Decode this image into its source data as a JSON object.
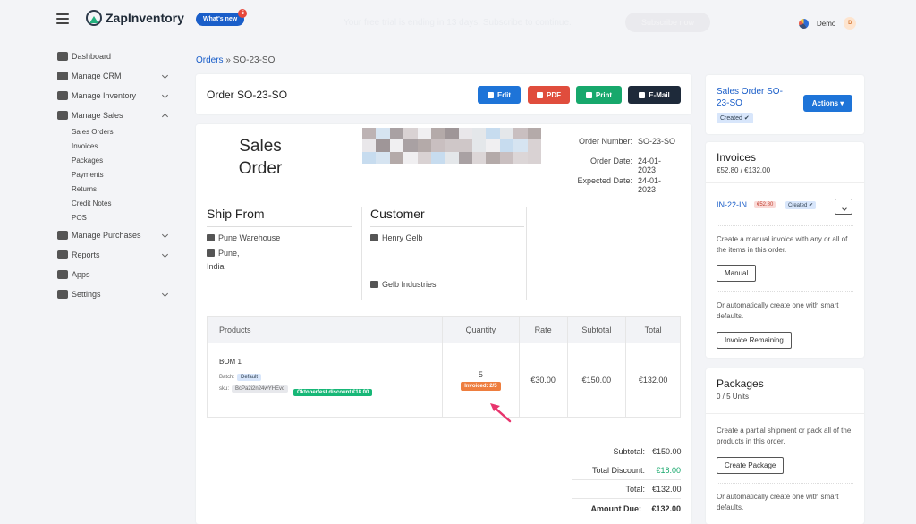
{
  "app": {
    "brand": "ZapInventory",
    "whats_new": "What's new",
    "whats_new_badge": "5",
    "trial_text": "Your free trial is ending in 13 days. Subscribe to continue.",
    "subscribe_label": "Subscribe now",
    "user_name": "Demo",
    "user_initial": "D"
  },
  "sidebar": {
    "items": [
      {
        "label": "Dashboard",
        "icon": "home-icon",
        "chevron": "none"
      },
      {
        "label": "Manage CRM",
        "icon": "users-icon",
        "chevron": "down"
      },
      {
        "label": "Manage Inventory",
        "icon": "inventory-icon",
        "chevron": "down"
      },
      {
        "label": "Manage Sales",
        "icon": "cart-icon",
        "chevron": "up"
      }
    ],
    "sales_sub": [
      "Sales Orders",
      "Invoices",
      "Packages",
      "Payments",
      "Returns",
      "Credit Notes",
      "POS"
    ],
    "items_after": [
      {
        "label": "Manage Purchases",
        "icon": "purchases-icon",
        "chevron": "down"
      },
      {
        "label": "Reports",
        "icon": "reports-icon",
        "chevron": "down"
      },
      {
        "label": "Apps",
        "icon": "apps-icon",
        "chevron": "none"
      },
      {
        "label": "Settings",
        "icon": "gear-icon",
        "chevron": "down"
      }
    ]
  },
  "breadcrumb": {
    "parent": "Orders",
    "separator": "»",
    "current": "SO-23-SO"
  },
  "order_header": {
    "title": "Order SO-23-SO",
    "edit": "Edit",
    "pdf": "PDF",
    "print": "Print",
    "email": "E-Mail"
  },
  "document": {
    "title_line1": "Sales",
    "title_line2": "Order",
    "meta": [
      {
        "k": "Order Number:",
        "v": "SO-23-SO"
      },
      {
        "k": "Order Date:",
        "v": "24-01-2023"
      },
      {
        "k": "Expected Date:",
        "v": "24-01-2023"
      }
    ],
    "ship_from_title": "Ship From",
    "warehouse": "Pune Warehouse",
    "city": "Pune,",
    "country": "India",
    "customer_title": "Customer",
    "customer_name": "Henry Gelb",
    "company": "Gelb Industries"
  },
  "products": {
    "headers": [
      "Products",
      "Quantity",
      "Rate",
      "Subtotal",
      "Total"
    ],
    "rows": [
      {
        "name": "BOM 1",
        "batch_label": "Batch:",
        "batch": "Default",
        "sku_label": "sku:",
        "sku": "BcPa2i2n24wYHEvq",
        "promo": "Oktoberfest discount €18.00",
        "quantity": "5",
        "invoiced": "Invoiced: 2/5",
        "rate": "€30.00",
        "subtotal": "€150.00",
        "total": "€132.00"
      }
    ]
  },
  "totals": [
    {
      "k": "Subtotal:",
      "v": "€150.00"
    },
    {
      "k": "Total Discount:",
      "v": "€18.00"
    },
    {
      "k": "Total:",
      "v": "€132.00"
    },
    {
      "k": "Amount Due:",
      "v": "€132.00"
    }
  ],
  "so_card": {
    "title": "Sales Order SO-23-SO",
    "status": "Created ✔",
    "actions": "Actions ▾"
  },
  "invoices_card": {
    "title": "Invoices",
    "sub": "€52.80 / €132.00",
    "invoice_id": "IN-22-IN",
    "invoice_amount": "€52.80",
    "invoice_status": "Created ✔",
    "manual_desc": "Create a manual invoice with any or all of the items in this order.",
    "manual_btn": "Manual",
    "auto_desc": "Or automatically create one with smart defaults.",
    "remaining_btn": "Invoice Remaining"
  },
  "packages_card": {
    "title": "Packages",
    "sub": "0 / 5 Units",
    "partial_desc": "Create a partial shipment or pack all of the products in this order.",
    "create_btn": "Create Package",
    "auto_desc": "Or automatically create one with smart defaults."
  },
  "colors": {
    "primary": "#1e74d8",
    "danger": "#e04d3d",
    "success": "#17a86c",
    "dark": "#1e2a3a",
    "invoiced": "#ee7e3f",
    "arrow": "#e8356d"
  }
}
